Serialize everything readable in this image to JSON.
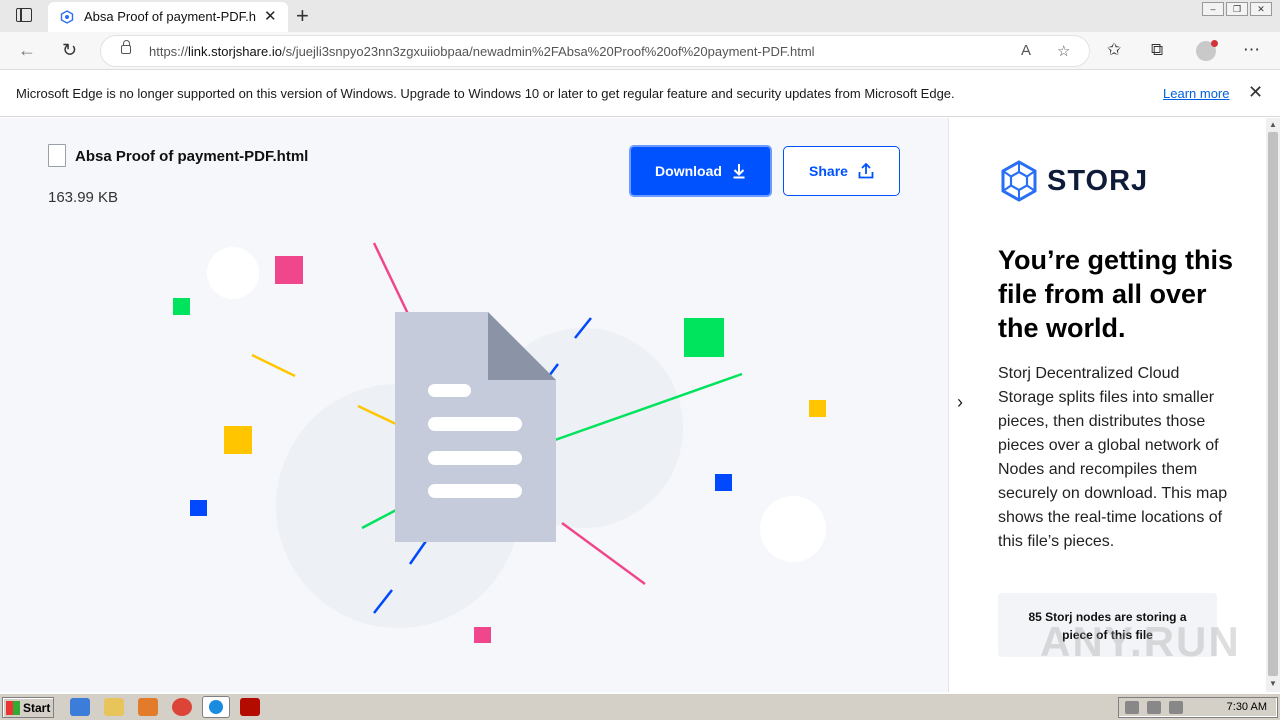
{
  "browser": {
    "tab_title": "Absa Proof of payment-PDF.htm",
    "tab_close": "✕",
    "new_tab": "+",
    "url_scheme": "https://",
    "url_host": "link.storjshare.io",
    "url_path": "/s/juejli3snpyo23nn3zgxuiiobpaa/newadmin%2FAbsa%20Proof%20of%20payment-PDF.html"
  },
  "infobar": {
    "message": "Microsoft Edge is no longer supported on this version of Windows. Upgrade to Windows 10 or later to get regular feature and security updates from Microsoft Edge.",
    "learn_more": "Learn more"
  },
  "file": {
    "name": "Absa Proof of payment-PDF.html",
    "size": "163.99 KB"
  },
  "actions": {
    "download_label": "Download",
    "share_label": "Share"
  },
  "sidebar": {
    "logo_text": "STORJ",
    "headline": "You’re getting this file from all over the world.",
    "description": "Storj Decentralized Cloud Storage splits files into smaller pieces, then distributes those pieces over a global network of Nodes and recompiles them securely on download. This map shows the real-time locations of this file’s pieces.",
    "nodes_text": "85 Storj nodes are storing a piece of this file"
  },
  "watermark": "ANY.RUN",
  "taskbar": {
    "start_label": "Start",
    "clock": "7:30 AM"
  },
  "colors": {
    "primary": "#0052ff",
    "pink": "#f0468b",
    "green": "#00e35c",
    "yellow": "#ffc600",
    "blue": "#0049ff"
  }
}
